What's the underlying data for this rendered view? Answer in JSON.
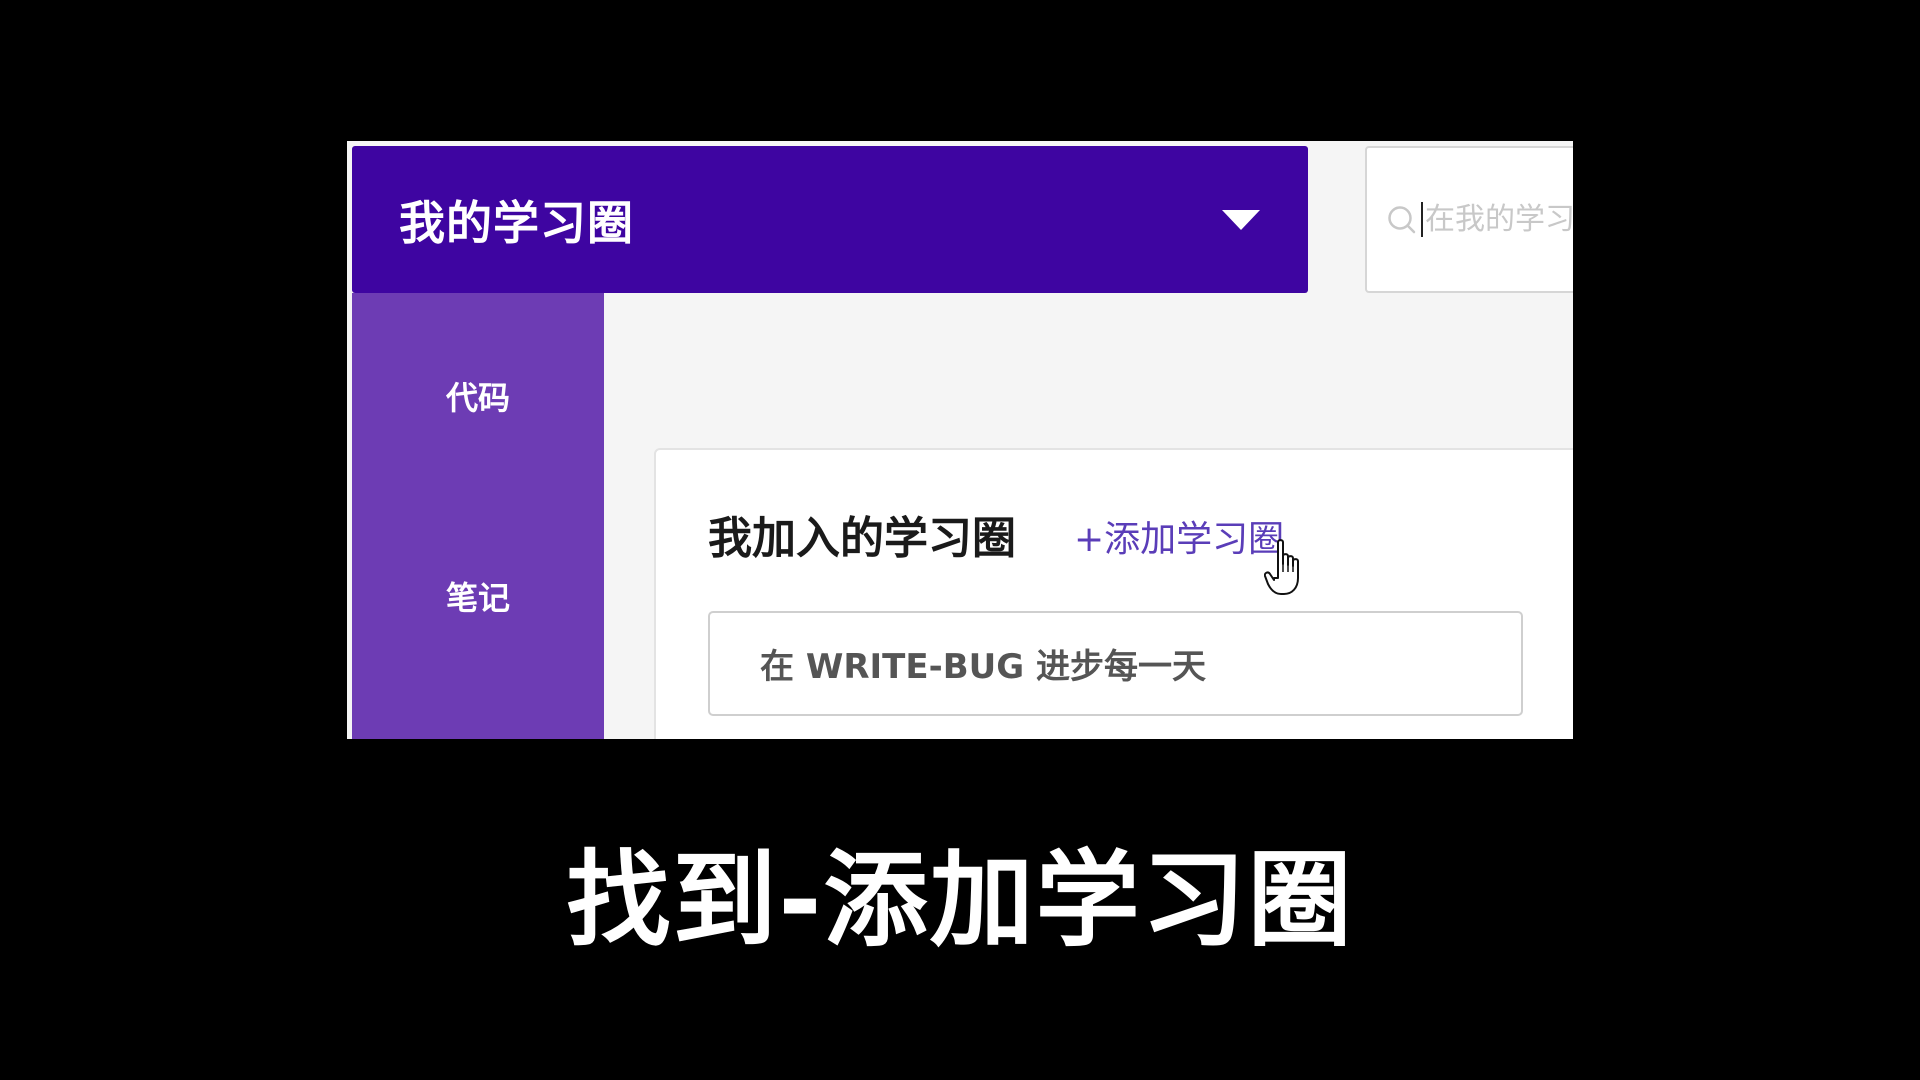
{
  "header": {
    "title": "我的学习圈",
    "dropdown_icon": "caret-down-icon"
  },
  "search": {
    "placeholder": "在我的学习圈中搜索",
    "icon": "search-icon"
  },
  "sidebar": {
    "items": [
      {
        "label": "代码"
      },
      {
        "label": "笔记"
      }
    ]
  },
  "card": {
    "title": "我加入的学习圈",
    "add_link": "+添加学习圈",
    "motto": "在 WRITE-BUG 进步每一天"
  },
  "caption": {
    "text": "找到-添加学习圈"
  },
  "colors": {
    "header_bg": "#3e05a1",
    "sidebar_bg": "#6d3cb4",
    "link": "#5a3db8",
    "content_bg": "#f5f5f5"
  }
}
